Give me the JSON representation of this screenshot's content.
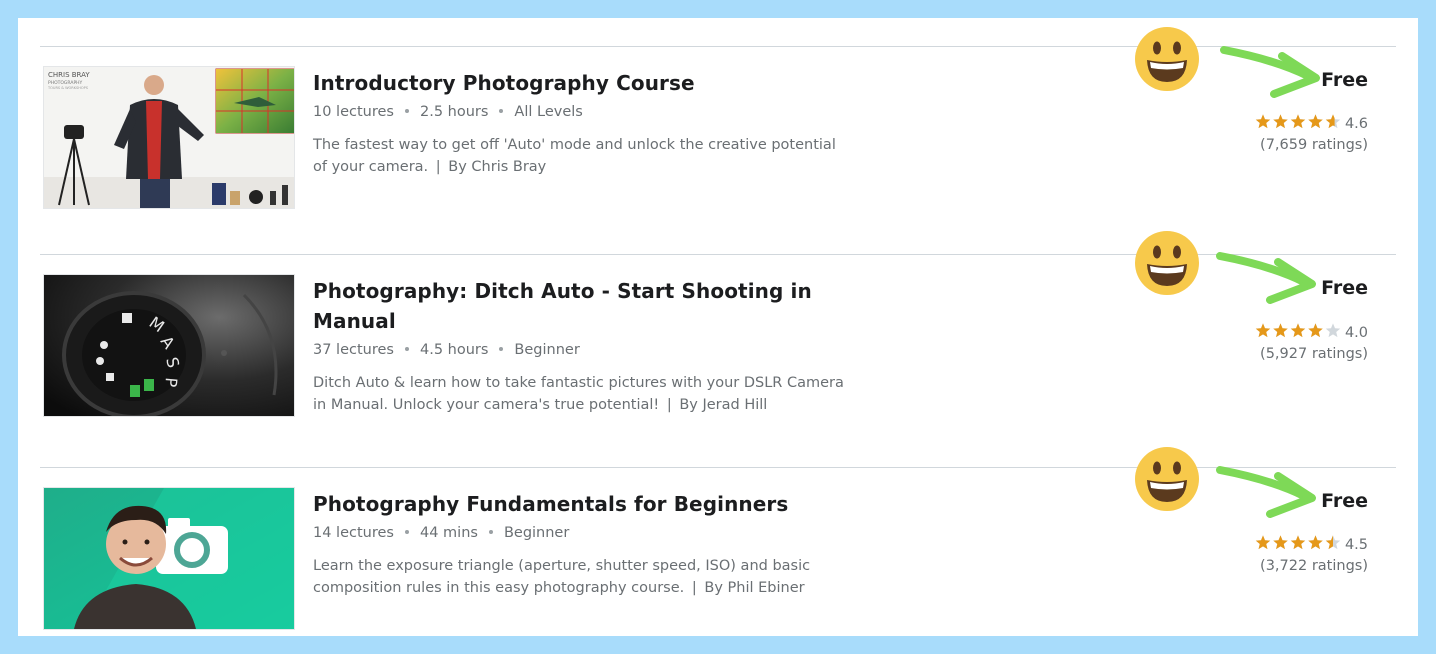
{
  "courses": [
    {
      "title": "Introductory Photography Course",
      "lectures": "10 lectures",
      "duration": "2.5 hours",
      "level": "All Levels",
      "description": "The fastest way to get off 'Auto' mode and unlock the creative potential of your camera.",
      "author": "By Chris Bray",
      "price": "Free",
      "rating": 4.6,
      "rating_text": "4.6",
      "ratings_count": "(7,659 ratings)",
      "thumbnail": {
        "label": "CHRIS BRAY",
        "sublabel": "PHOTOGRAPHY",
        "subsublabel": "TOURS & WORKSHOPS"
      }
    },
    {
      "title": "Photography: Ditch Auto - Start Shooting in Manual",
      "lectures": "37 lectures",
      "duration": "4.5 hours",
      "level": "Beginner",
      "description": "Ditch Auto & learn how to take fantastic pictures with your DSLR Camera in Manual. Unlock your camera's true potential!",
      "author": "By Jerad Hill",
      "price": "Free",
      "rating": 4.0,
      "rating_text": "4.0",
      "ratings_count": "(5,927 ratings)"
    },
    {
      "title": "Photography Fundamentals for Beginners",
      "lectures": "14 lectures",
      "duration": "44 mins",
      "level": "Beginner",
      "description": "Learn the exposure triangle (aperture, shutter speed, ISO) and basic composition rules in this easy photography course.",
      "author": "By Phil Ebiner",
      "price": "Free",
      "rating": 4.5,
      "rating_text": "4.5",
      "ratings_count": "(3,722 ratings)"
    }
  ],
  "separator": "|",
  "colors": {
    "star": "#e59819",
    "star_empty": "#d1d7dc",
    "arrow": "#7ed957",
    "smiley": "#f7c94b",
    "frame": "#a8dcfb"
  },
  "icons": [
    "smiley-icon",
    "arrow-icon",
    "star-icon"
  ]
}
